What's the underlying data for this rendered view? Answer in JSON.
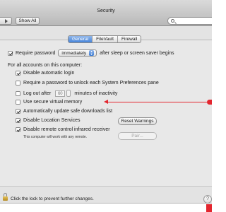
{
  "window": {
    "title": "Security"
  },
  "toolbar": {
    "show_all_label": "Show All"
  },
  "tabs": [
    {
      "label": "General",
      "active": true
    },
    {
      "label": "FileVault",
      "active": false
    },
    {
      "label": "Firewall",
      "active": false
    }
  ],
  "general": {
    "require_password": {
      "label": "Require password",
      "checked": true,
      "delay_value": "immediately",
      "suffix": "after sleep or screen saver begins"
    },
    "all_accounts_heading": "For all accounts on this computer:",
    "options": [
      {
        "label": "Disable automatic login",
        "checked": true
      },
      {
        "label": "Require a password to unlock each System Preferences pane",
        "checked": false
      },
      {
        "label": "Log out after",
        "checked": false,
        "minutes_value": "60",
        "suffix": "minutes of inactivity"
      },
      {
        "label": "Use secure virtual memory",
        "checked": false
      },
      {
        "label": "Automatically update safe downloads list",
        "checked": true
      },
      {
        "label": "Disable Location Services",
        "checked": true
      },
      {
        "label": "Disable remote control infrared receiver",
        "checked": true
      }
    ],
    "reset_warnings_label": "Reset Warnings",
    "pair_label": "Pair...",
    "ir_note": "This computer will work with any remote."
  },
  "footer": {
    "lock_text": "Click the lock to prevent further changes.",
    "help_label": "?"
  },
  "colors": {
    "annotation_arrow": "#e3262f",
    "tab_active": "#3f7fd8"
  },
  "icons": [
    "back-arrow-icon",
    "grid-icon",
    "search-icon",
    "lock-icon",
    "help-icon"
  ]
}
